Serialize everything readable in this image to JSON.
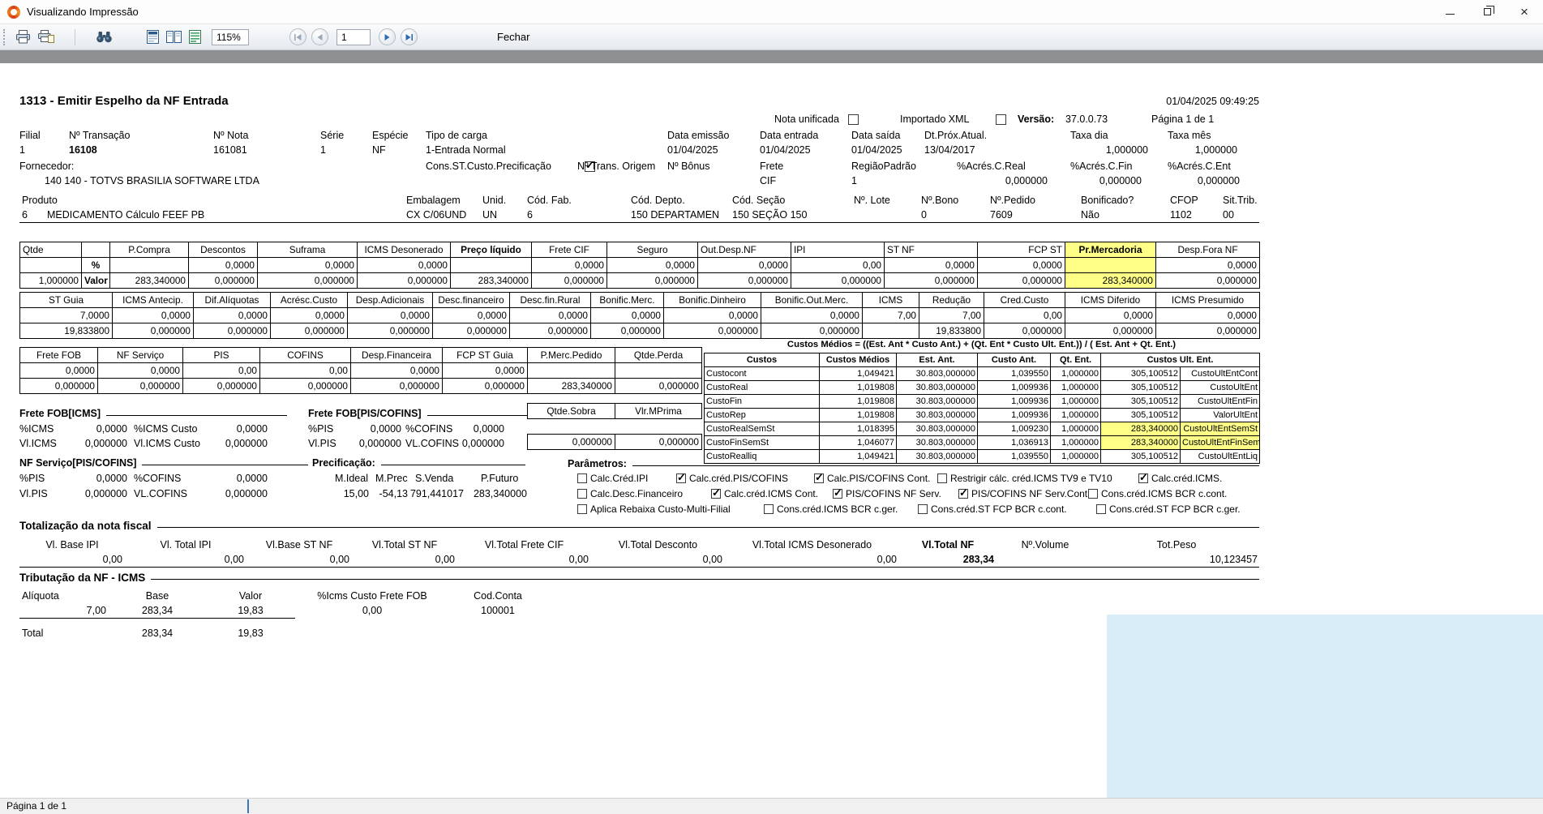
{
  "window": {
    "title": "Visualizando Impressão"
  },
  "toolbar": {
    "zoom": "115%",
    "page": "1",
    "close": "Fechar"
  },
  "statusbar": {
    "text": "Página 1 de 1"
  },
  "doc": {
    "title": "1313 - Emitir Espelho da NF Entrada",
    "datetime": "01/04/2025 09:49:25",
    "meta": {
      "nota": "Nota unificada",
      "xml": "Importado XML",
      "versao_lbl": "Versão:",
      "versao": "37.0.0.73",
      "pagina": "Página 1 de 1"
    },
    "header_fields": [
      {
        "label": "Filial",
        "value": "1"
      },
      {
        "label": "Nº Transação",
        "value": "16108",
        "vb": 1
      },
      {
        "label": "Nº Nota",
        "value": "161081"
      },
      {
        "label": "Série",
        "value": "1"
      },
      {
        "label": "Espécie",
        "value": "NF"
      },
      {
        "label": "Tipo de carga",
        "value": "1-Entrada Normal"
      },
      {
        "label": "Data emissão",
        "value": "01/04/2025"
      },
      {
        "label": "Data entrada",
        "value": "01/04/2025"
      },
      {
        "label": "Data saída",
        "value": "01/04/2025"
      },
      {
        "label": "Dt.Próx.Atual.",
        "value": "13/04/2017"
      },
      {
        "label": "Taxa dia",
        "value": "1,000000",
        "ra": 1
      },
      {
        "label": "Taxa mês",
        "value": "1,000000",
        "ra": 1
      }
    ],
    "supplier": {
      "lbl": "Fornecedor:",
      "name": "140 140 - TOTVS BRASILIA SOFTWARE LTDA",
      "cons_lbl": "Cons.ST.Custo.Precificação",
      "origem_lbl": "Nº Trans. Origem",
      "bonus_lbl": "Nº Bônus",
      "frete_lbl": "Frete",
      "frete_val": "CIF",
      "regiao_lbl": "RegiãoPadrão",
      "regiao_val": "1",
      "ar_lbl": "%Acrés.C.Real",
      "ar_val": "0,000000",
      "af_lbl": "%Acrés.C.Fin",
      "af_val": "0,000000",
      "ae_lbl": "%Acrés.C.Ent",
      "ae_val": "0,000000"
    },
    "product": {
      "headers": [
        {
          "t": "Produto",
          "span": 2,
          "l": 1
        },
        {
          "t": "Embalagem",
          "l": 1
        },
        {
          "t": "Unid.",
          "l": 1
        },
        {
          "t": "Cód. Fab.",
          "l": 1
        },
        {
          "t": "Cód. Depto.",
          "l": 1
        },
        {
          "t": "Cód. Seção",
          "l": 1
        },
        {
          "t": "Nº. Lote",
          "l": 1
        },
        {
          "t": "Nº.Bono",
          "l": 1
        },
        {
          "t": "Nº.Pedido",
          "l": 1
        },
        {
          "t": "Bonificado?",
          "l": 1
        },
        {
          "t": "CFOP",
          "l": 1
        },
        {
          "t": "Sit.Trib.",
          "l": 1
        }
      ],
      "rows": [
        [
          {
            "t": "6",
            "l": 1
          },
          {
            "t": "MEDICAMENTO Cálculo FEEF PB",
            "l": 1
          },
          {
            "t": "CX C/06UND",
            "l": 1
          },
          {
            "t": "UN",
            "l": 1
          },
          {
            "t": "6",
            "l": 1
          },
          {
            "t": "150 DEPARTAMEN",
            "l": 1
          },
          {
            "t": "150 SEÇÃO 150",
            "l": 1
          },
          {
            "t": ""
          },
          {
            "t": "0",
            "l": 1
          },
          {
            "t": "7609",
            "l": 1
          },
          {
            "t": "Não",
            "l": 1
          },
          {
            "t": "1102",
            "l": 1
          },
          {
            "t": "00",
            "l": 1
          }
        ]
      ]
    },
    "table1": {
      "headers": [
        {
          "t": "Qtde",
          "l": 1
        },
        {
          "t": ""
        },
        {
          "t": "P.Compra",
          "c": 1
        },
        {
          "t": "Descontos",
          "c": 1
        },
        {
          "t": "Suframa",
          "c": 1
        },
        {
          "t": "ICMS Desonerado",
          "c": 1
        },
        {
          "t": "Preço líquido",
          "c": 1,
          "b": 1
        },
        {
          "t": "Frete CIF",
          "c": 1
        },
        {
          "t": "Seguro",
          "c": 1
        },
        {
          "t": "Out.Desp.NF",
          "l": 1
        },
        {
          "t": "IPI",
          "l": 1
        },
        {
          "t": "ST NF",
          "l": 1
        },
        {
          "t": "FCP ST",
          "r": 1
        },
        {
          "t": "Pr.Mercadoria",
          "c": 1,
          "b": 1,
          "y": 1
        },
        {
          "t": "Desp.Fora NF",
          "c": 1
        }
      ],
      "rows": [
        [
          "",
          {
            "t": "%",
            "c": 1,
            "b": 1
          },
          "",
          "0,0000",
          "0,0000",
          "0,0000",
          "",
          "0,0000",
          "0,0000",
          "0,0000",
          "0,00",
          "0,0000",
          "0,0000",
          {
            "t": "",
            "y": 1
          },
          "0,0000"
        ],
        [
          "1,000000",
          {
            "t": "Valor",
            "c": 1,
            "b": 1
          },
          "283,340000",
          "0,000000",
          "0,000000",
          "0,000000",
          "283,340000",
          "0,000000",
          "0,000000",
          "0,000000",
          "0,000000",
          "0,000000",
          "0,000000",
          {
            "t": "283,340000",
            "y": 1
          },
          "0,000000"
        ]
      ]
    },
    "table2": {
      "headers": [
        {
          "t": "ST Guia",
          "c": 1
        },
        {
          "t": "ICMS Antecip.",
          "c": 1
        },
        {
          "t": "Dif.Alíquotas",
          "c": 1
        },
        {
          "t": "Acrésc.Custo",
          "c": 1
        },
        {
          "t": "Desp.Adicionais",
          "c": 1
        },
        {
          "t": "Desc.financeiro",
          "c": 1
        },
        {
          "t": "Desc.fin.Rural",
          "c": 1
        },
        {
          "t": "Bonific.Merc.",
          "c": 1
        },
        {
          "t": "Bonific.Dinheiro",
          "c": 1
        },
        {
          "t": "Bonific.Out.Merc.",
          "c": 1
        },
        {
          "t": "ICMS",
          "c": 1
        },
        {
          "t": "Redução",
          "c": 1
        },
        {
          "t": "Cred.Custo",
          "c": 1
        },
        {
          "t": "ICMS Diferido",
          "c": 1
        },
        {
          "t": "ICMS Presumido",
          "c": 1
        }
      ],
      "rows": [
        [
          "7,0000",
          "0,0000",
          "0,0000",
          "0,0000",
          "0,0000",
          "0,0000",
          "0,0000",
          "0,0000",
          "0,0000",
          "0,0000",
          "7,00",
          "7,00",
          "0,00",
          "0,0000",
          "0,0000"
        ],
        [
          "19,833800",
          "0,000000",
          "0,000000",
          "0,000000",
          "0,000000",
          "0,000000",
          "0,000000",
          "0,000000",
          "0,000000",
          "0,000000",
          "",
          "19,833800",
          "0,000000",
          "0,000000",
          "0,000000"
        ]
      ]
    },
    "table3": {
      "headers": [
        {
          "t": "Frete FOB",
          "c": 1
        },
        {
          "t": "NF Serviço",
          "c": 1
        },
        {
          "t": "PIS",
          "c": 1
        },
        {
          "t": "COFINS",
          "c": 1
        },
        {
          "t": "Desp.Financeira",
          "c": 1
        },
        {
          "t": "FCP ST Guia",
          "c": 1
        },
        {
          "t": "P.Merc.Pedido",
          "c": 1
        },
        {
          "t": "Qtde.Perda",
          "c": 1
        }
      ],
      "rows": [
        [
          "0,0000",
          "0,0000",
          "0,00",
          "0,00",
          "0,0000",
          "0,0000",
          "",
          ""
        ],
        [
          "0,000000",
          "0,000000",
          "0,000000",
          "0,000000",
          "0,000000",
          "0,000000",
          "283,340000",
          "0,000000"
        ]
      ]
    },
    "custos": {
      "formula": "Custos Médios = ((Est. Ant * Custo Ant.) + (Qt. Ent * Custo Ult. Ent.)) / ( Est. Ant + Qt. Ent.)",
      "table": {
        "headers": [
          {
            "t": "Custos",
            "c": 1,
            "b": 1
          },
          {
            "t": "Custos Médios",
            "c": 1,
            "b": 1
          },
          {
            "t": "Est. Ant.",
            "c": 1,
            "b": 1
          },
          {
            "t": "Custo Ant.",
            "c": 1,
            "b": 1
          },
          {
            "t": "Qt. Ent.",
            "c": 1,
            "b": 1
          },
          {
            "t": "Custos Ult. Ent.",
            "c": 1,
            "b": 1,
            "span": 2
          }
        ],
        "rows": [
          [
            {
              "t": "Custocont",
              "l": 1
            },
            "1,049421",
            "30.803,000000",
            "1,039550",
            "1,000000",
            "305,100512",
            "CustoUltEntCont"
          ],
          [
            {
              "t": "CustoReal",
              "l": 1
            },
            "1,019808",
            "30.803,000000",
            "1,009936",
            "1,000000",
            "305,100512",
            "CustoUltEnt"
          ],
          [
            {
              "t": "CustoFin",
              "l": 1
            },
            "1,019808",
            "30.803,000000",
            "1,009936",
            "1,000000",
            "305,100512",
            "CustoUltEntFin"
          ],
          [
            {
              "t": "CustoRep",
              "l": 1
            },
            "1,019808",
            "30.803,000000",
            "1,009936",
            "1,000000",
            "305,100512",
            "ValorUltEnt"
          ],
          [
            {
              "t": "CustoRealSemSt",
              "l": 1
            },
            "1,018395",
            "30.803,000000",
            "1,009230",
            "1,000000",
            {
              "t": "283,340000",
              "y": 1
            },
            {
              "t": "CustoUltEntSemSt",
              "y": 1
            }
          ],
          [
            {
              "t": "CustoFinSemSt",
              "l": 1
            },
            "1,046077",
            "30.803,000000",
            "1,036913",
            "1,000000",
            {
              "t": "283,340000",
              "y": 1
            },
            {
              "t": "CustoUltEntFinSemSt",
              "y": 1
            }
          ],
          [
            {
              "t": "CustoRealliq",
              "l": 1
            },
            "1,049421",
            "30.803,000000",
            "1,039550",
            "1,000000",
            "305,100512",
            "CustoUltEntLiq"
          ]
        ]
      }
    },
    "sobra": {
      "head": {
        "headers": [
          {
            "t": "Qtde.Sobra",
            "c": 1
          },
          {
            "t": "Vlr.MPrima",
            "c": 1
          }
        ]
      },
      "vals": {
        "rows": [
          [
            "0,000000",
            "0,000000"
          ]
        ]
      }
    },
    "fob": {
      "hdr1": "Frete FOB[ICMS]",
      "hdr2": "Frete FOB[PIS/COFINS]",
      "l_picms": "%ICMS",
      "v_picms": "0,0000",
      "l_picmsc": "%ICMS Custo",
      "v_picmsc": "0,0000",
      "l_ppis": "%PIS",
      "v_ppis": "0,0000",
      "l_pcof": "%COFINS",
      "v_pcof": "0,0000",
      "l_vicms": "Vl.ICMS",
      "v_vicms": "0,000000",
      "l_vicmsc": "Vl.ICMS Custo",
      "v_vicmsc": "0,000000",
      "l_vpis": "Vl.PIS",
      "v_vpis": "0,000000",
      "l_vcof": "VL.COFINS",
      "v_vcof": "0,000000"
    },
    "nfserv": {
      "hdr": "NF Serviço[PIS/COFINS]",
      "l_ppis": "%PIS",
      "v_ppis": "0,0000",
      "l_pcof": "%COFINS",
      "v_pcof": "0,0000",
      "l_vpis": "Vl.PIS",
      "v_vpis": "0,000000",
      "l_vcof": "VL.COFINS",
      "v_vcof": "0,000000"
    },
    "precif": {
      "hdr": "Precificação:",
      "labels": [
        "M.Ideal",
        "M.Prec",
        "S.Venda",
        "P.Futuro"
      ],
      "values": [
        "15,00",
        "-54,13",
        "791,441017",
        "283,340000"
      ]
    },
    "params": {
      "hdr": "Parâmetros:",
      "rows": {
        "r1": [
          {
            "c": 0,
            "t": "Calc.Créd.IPI"
          },
          {
            "c": 1,
            "t": "Calc.créd.PIS/COFINS"
          },
          {
            "c": 1,
            "t": "Calc.PIS/COFINS Cont."
          },
          {
            "c": 0,
            "t": "Restrigir cálc. créd.ICMS TV9 e TV10"
          },
          {
            "c": 1,
            "t": "Calc.créd.ICMS."
          }
        ],
        "r2": [
          {
            "c": 0,
            "t": "Calc.Desc.Financeiro"
          },
          {
            "c": 1,
            "t": "Calc.créd.ICMS Cont."
          },
          {
            "c": 1,
            "t": "PIS/COFINS NF Serv."
          },
          {
            "c": 1,
            "t": "PIS/COFINS NF Serv.Cont"
          },
          {
            "c": 0,
            "t": "Cons.créd.ICMS BCR c.cont."
          }
        ],
        "r3": [
          {
            "c": 0,
            "t": "Aplica Rebaixa Custo-Multi-Filial"
          },
          {
            "c": 0,
            "t": "Cons.créd.ICMS BCR c.ger."
          },
          {
            "c": 0,
            "t": "Cons.créd.ST FCP BCR c.cont."
          },
          {
            "c": 0,
            "t": "Cons.créd.ST FCP BCR c.ger."
          }
        ]
      }
    },
    "totals": {
      "title": "Totalização da nota fiscal",
      "table": {
        "headers": [
          {
            "t": "Vl. Base IPI",
            "c": 1
          },
          {
            "t": "Vl. Total IPI",
            "c": 1
          },
          {
            "t": "Vl.Base ST NF",
            "c": 1
          },
          {
            "t": "Vl.Total ST NF",
            "c": 1
          },
          {
            "t": "Vl.Total Frete CIF",
            "c": 1
          },
          {
            "t": "Vl.Total Desconto",
            "c": 1
          },
          {
            "t": "Vl.Total ICMS Desonerado",
            "c": 1
          },
          {
            "t": "Vl.Total NF",
            "c": 1,
            "b": 1
          },
          {
            "t": "Nº.Volume",
            "c": 1
          },
          {
            "t": "Tot.Peso",
            "c": 1
          }
        ],
        "rows": [
          [
            "0,00",
            "0,00",
            "0,00",
            "0,00",
            "0,00",
            "0,00",
            "0,00",
            {
              "t": "283,34",
              "b": 1
            },
            "",
            "10,123457"
          ]
        ]
      }
    },
    "trib": {
      "title": "Tributação da NF - ICMS",
      "table": {
        "headers": [
          {
            "t": "Alíquota",
            "l": 1
          },
          {
            "t": "Base",
            "c": 1
          },
          {
            "t": "Valor",
            "c": 1
          },
          {
            "t": "%Icms Custo Frete FOB",
            "c": 1
          },
          {
            "t": "Cod.Conta",
            "c": 1
          }
        ],
        "rows": [
          [
            "7,00",
            {
              "t": "283,34",
              "c": 1
            },
            {
              "t": "19,83",
              "c": 1
            },
            {
              "t": "0,00",
              "c": 1
            },
            {
              "t": "100001",
              "c": 1
            }
          ],
          [
            {
              "t": "Total",
              "l": 1
            },
            {
              "t": "283,34",
              "c": 1
            },
            {
              "t": "19,83",
              "c": 1
            },
            {
              "t": ""
            },
            {
              "t": ""
            }
          ]
        ]
      }
    }
  }
}
